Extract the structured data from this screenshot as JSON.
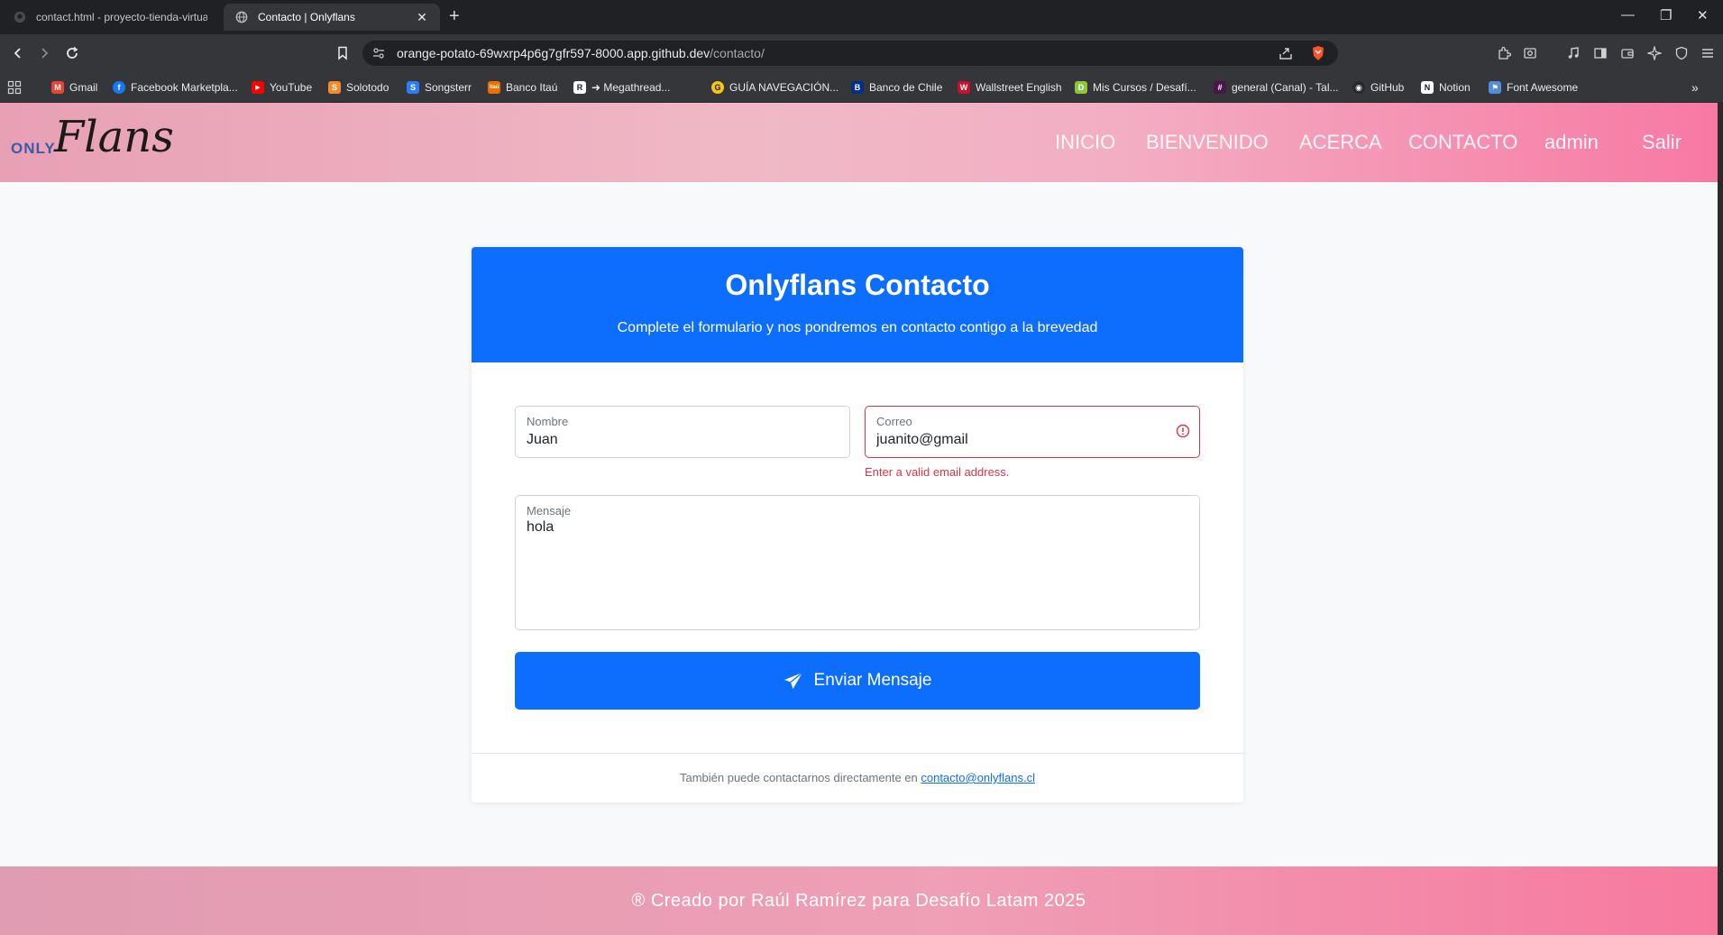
{
  "browser": {
    "tabs": [
      {
        "label": "contact.html - proyecto-tienda-virtual",
        "active": false
      },
      {
        "label": "Contacto | Onlyflans",
        "active": true
      }
    ],
    "new_tab": "+",
    "window_controls": {
      "minimize": "—",
      "restore": "❐",
      "close": "✕"
    },
    "url_host": "orange-potato-69wxrp4p6g7gfr597-8000.app.github.dev",
    "url_path": "/contacto/",
    "bookmarks": [
      {
        "label": "Gmail",
        "color": "#ea4335",
        "glyph": "M"
      },
      {
        "label": "Facebook Marketpla...",
        "color": "#1877f2",
        "glyph": "f"
      },
      {
        "label": "YouTube",
        "color": "#ff0000",
        "glyph": "▶"
      },
      {
        "label": "Solotodo",
        "color": "#f08c2b",
        "glyph": "S"
      },
      {
        "label": "Songsterr",
        "color": "#2d7cf6",
        "glyph": "S"
      },
      {
        "label": "Banco Itaú",
        "color": "#ec7000",
        "glyph": "itaú"
      },
      {
        "label": "➜ Megathread...",
        "color": "#ffffff",
        "glyph": "R"
      },
      {
        "label": "GUÍA NAVEGACIÓN...",
        "color": "#f5c518",
        "glyph": "G"
      },
      {
        "label": "Banco de Chile",
        "color": "#002f87",
        "glyph": "B"
      },
      {
        "label": "Wallstreet English",
        "color": "#c8102e",
        "glyph": "W"
      },
      {
        "label": "Mis Cursos / Desafí...",
        "color": "#8cc63f",
        "glyph": "D"
      },
      {
        "label": "general (Canal) - Tal...",
        "color": "#4a154b",
        "glyph": "#"
      },
      {
        "label": "GitHub",
        "color": "#24292f",
        "glyph": "◉"
      },
      {
        "label": "Notion",
        "color": "#ffffff",
        "glyph": "N"
      },
      {
        "label": "Font Awesome",
        "color": "#538dd7",
        "glyph": "⚑"
      }
    ]
  },
  "site": {
    "logo_only": "ONLY",
    "logo_flans": "Flans",
    "nav": [
      "INICIO",
      "BIENVENIDO",
      "ACERCA",
      "CONTACTO",
      "admin",
      "Salir"
    ]
  },
  "form": {
    "title": "Onlyflans Contacto",
    "subtitle": "Complete el formulario y nos pondremos en contacto contigo a la brevedad",
    "name": {
      "label": "Nombre",
      "value": "Juan"
    },
    "email": {
      "label": "Correo",
      "value": "juanito@gmail",
      "error": "Enter a valid email address."
    },
    "message": {
      "label": "Mensaje",
      "value": "hola"
    },
    "submit_label": "Enviar Mensaje",
    "footer_prefix": "También puede contactarnos directamente en ",
    "footer_email": "contacto@onlyflans.cl"
  },
  "footer": {
    "text": "® Creado por Raúl Ramírez para Desafío Latam 2025"
  },
  "colors": {
    "primary": "#0d6efd",
    "danger": "#dc3545",
    "header_pink": "#f779a3"
  }
}
